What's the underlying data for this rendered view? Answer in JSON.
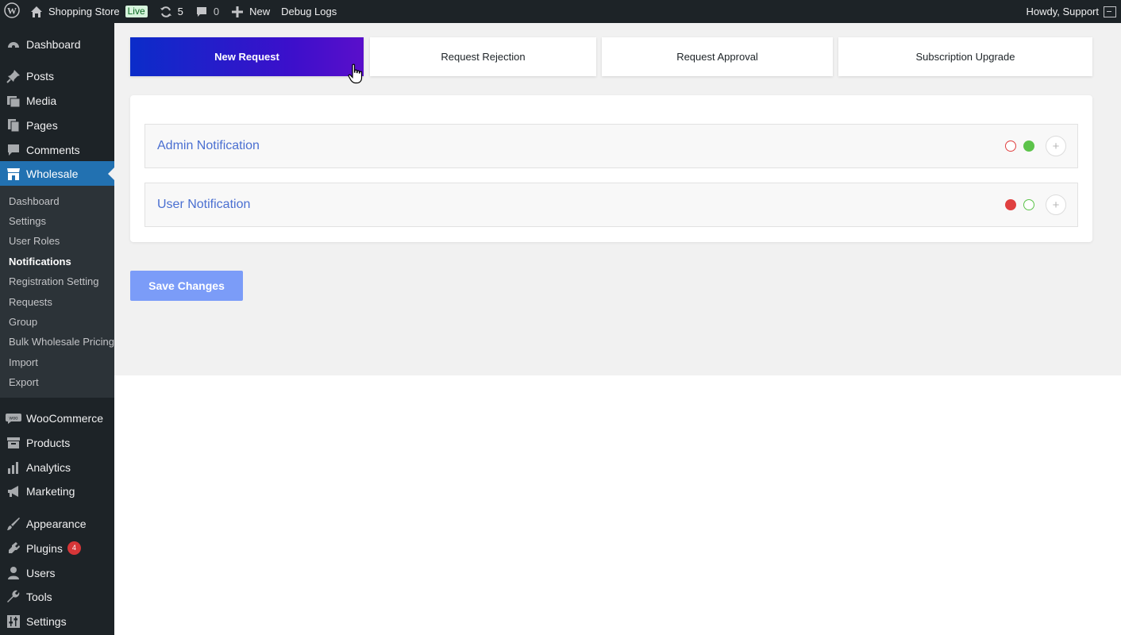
{
  "admin_bar": {
    "site_name": "Shopping Store",
    "live_label": "Live",
    "updates_count": "5",
    "comments_count": "0",
    "new_label": "New",
    "debug_label": "Debug Logs",
    "greeting": "Howdy, Support"
  },
  "sidebar": {
    "items": [
      {
        "label": "Dashboard",
        "icon": "dashboard-icon"
      },
      {
        "label": "Posts",
        "icon": "pin-icon"
      },
      {
        "label": "Media",
        "icon": "media-icon"
      },
      {
        "label": "Pages",
        "icon": "pages-icon"
      },
      {
        "label": "Comments",
        "icon": "comment-icon"
      },
      {
        "label": "Wholesale",
        "icon": "store-icon"
      },
      {
        "label": "WooCommerce",
        "icon": "woo-icon"
      },
      {
        "label": "Products",
        "icon": "archive-icon"
      },
      {
        "label": "Analytics",
        "icon": "chart-icon"
      },
      {
        "label": "Marketing",
        "icon": "megaphone-icon"
      },
      {
        "label": "Appearance",
        "icon": "brush-icon"
      },
      {
        "label": "Plugins",
        "icon": "plug-icon",
        "badge": "4"
      },
      {
        "label": "Users",
        "icon": "user-icon"
      },
      {
        "label": "Tools",
        "icon": "wrench-icon"
      },
      {
        "label": "Settings",
        "icon": "sliders-icon"
      }
    ],
    "submenu": [
      "Dashboard",
      "Settings",
      "User Roles",
      "Notifications",
      "Registration Setting",
      "Requests",
      "Group",
      "Bulk Wholesale Pricing",
      "Import",
      "Export"
    ]
  },
  "tabs": [
    "New Request",
    "Request Rejection",
    "Request Approval",
    "Subscription Upgrade"
  ],
  "notifications": [
    {
      "title": "Admin Notification"
    },
    {
      "title": "User Notification"
    }
  ],
  "save_label": "Save Changes",
  "colors": {
    "accent": "#2271b1",
    "tab_gradient_start": "#0b2cc9",
    "tab_gradient_end": "#5a0fcb",
    "save_button": "#7b9cf8",
    "status_red": "#e04040",
    "status_green": "#5cc34a"
  }
}
